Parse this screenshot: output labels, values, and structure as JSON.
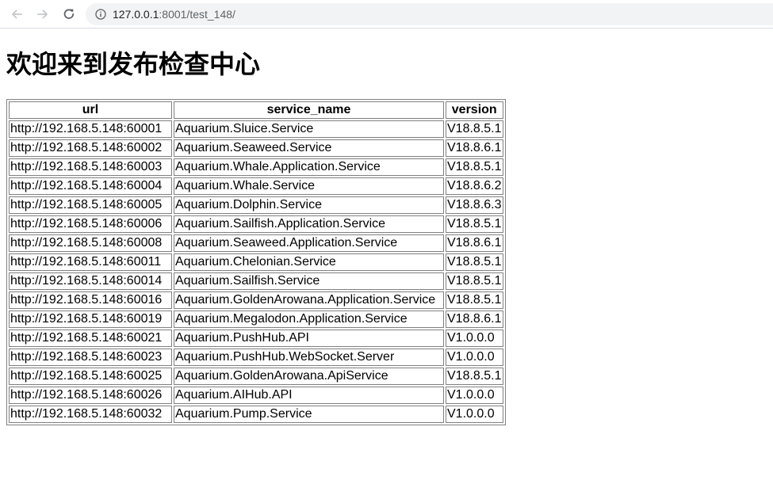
{
  "browser": {
    "url_host": "127.0.0.1",
    "url_rest": ":8001/test_148/",
    "back_icon": "arrow-left-icon",
    "forward_icon": "arrow-right-icon",
    "reload_icon": "reload-icon",
    "info_icon": "info-icon"
  },
  "page": {
    "title": "欢迎来到发布检查中心"
  },
  "table": {
    "headers": [
      "url",
      "service_name",
      "version"
    ],
    "rows": [
      [
        "http://192.168.5.148:60001",
        "Aquarium.Sluice.Service",
        "V18.8.5.1"
      ],
      [
        "http://192.168.5.148:60002",
        "Aquarium.Seaweed.Service",
        "V18.8.6.1"
      ],
      [
        "http://192.168.5.148:60003",
        "Aquarium.Whale.Application.Service",
        "V18.8.5.1"
      ],
      [
        "http://192.168.5.148:60004",
        "Aquarium.Whale.Service",
        "V18.8.6.2"
      ],
      [
        "http://192.168.5.148:60005",
        "Aquarium.Dolphin.Service",
        "V18.8.6.3"
      ],
      [
        "http://192.168.5.148:60006",
        "Aquarium.Sailfish.Application.Service",
        "V18.8.5.1"
      ],
      [
        "http://192.168.5.148:60008",
        "Aquarium.Seaweed.Application.Service",
        "V18.8.6.1"
      ],
      [
        "http://192.168.5.148:60011",
        "Aquarium.Chelonian.Service",
        "V18.8.5.1"
      ],
      [
        "http://192.168.5.148:60014",
        "Aquarium.Sailfish.Service",
        "V18.8.5.1"
      ],
      [
        "http://192.168.5.148:60016",
        "Aquarium.GoldenArowana.Application.Service",
        "V18.8.5.1"
      ],
      [
        "http://192.168.5.148:60019",
        "Aquarium.Megalodon.Application.Service",
        "V18.8.6.1"
      ],
      [
        "http://192.168.5.148:60021",
        "Aquarium.PushHub.API",
        "V1.0.0.0"
      ],
      [
        "http://192.168.5.148:60023",
        "Aquarium.PushHub.WebSocket.Server",
        "V1.0.0.0"
      ],
      [
        "http://192.168.5.148:60025",
        "Aquarium.GoldenArowana.ApiService",
        "V18.8.5.1"
      ],
      [
        "http://192.168.5.148:60026",
        "Aquarium.AIHub.API",
        "V1.0.0.0"
      ],
      [
        "http://192.168.5.148:60032",
        "Aquarium.Pump.Service",
        "V1.0.0.0"
      ]
    ]
  }
}
